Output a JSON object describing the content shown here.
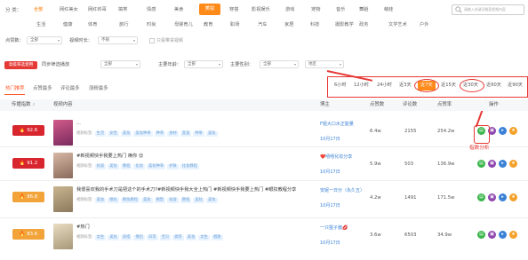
{
  "category": {
    "label": "分  类：",
    "row1": [
      "全部",
      "网红美女",
      "网红帅哥",
      "搞笑",
      "情感",
      "美食",
      "美妆",
      "穿搭",
      "影视娱乐",
      "游戏",
      "宠物",
      "音乐",
      "舞蹈",
      "萌娃"
    ],
    "row2": [
      "生活",
      "健康",
      "体育",
      "旅行",
      "时尚",
      "母婴育儿",
      "教育",
      "职场",
      "汽车",
      "家居",
      "科技",
      "摄影教学",
      "政务",
      "文学艺术",
      "户外"
    ],
    "selected_top": "全部",
    "active": "美妆"
  },
  "search": {
    "placeholder": "请输入关键词搜索视频内容"
  },
  "filters": {
    "fans_label": "点赞数：",
    "fans_value": "全部",
    "duration_label": "视频时长：",
    "duration_value": "不限",
    "checkbox_label": "只看带货视频"
  },
  "advanced": {
    "button": "高级筛选使用",
    "opt1_label": "同步筛选播放",
    "opt2_label": "首页发布：",
    "opt2_value": "全部",
    "opt3_label": "主要年龄：",
    "opt3_value": "全部",
    "opt4_label": "主要性别：",
    "opt4_value": "全部",
    "opt5_value": "地区"
  },
  "tabs": [
    "热门推荐",
    "点赞最多",
    "评论最多",
    "涨粉最多"
  ],
  "time_range": [
    "6小时",
    "12小时",
    "24小时",
    "近3天",
    "近7天",
    "近15天",
    "近30天",
    "近60天",
    "近90天"
  ],
  "time_selected": "近7天",
  "table": {
    "headers": {
      "score": "传播指数",
      "video": "视频内容",
      "blogger": "博主",
      "likes": "点赞数",
      "comments": "评论数",
      "plays": "点赞率",
      "ops": "操作"
    }
  },
  "rows": [
    {
      "score": "92.6",
      "title": "...",
      "tags_label": "视频标签:",
      "tags": [
        "生活",
        "女性",
        "美妆",
        "美妆种草",
        "种草",
        "身材",
        "变美",
        "种草",
        "美妆"
      ],
      "blogger": "F姐大口水正能量",
      "date": "10月17日",
      "likes": "6.4w",
      "comments": "2155",
      "plays": "254.2w"
    },
    {
      "score": "91.2",
      "title": "#新视频快手我要上热门 唤你 😍",
      "tags_label": "视频标签:",
      "tags": [
        "妆容",
        "美妆",
        "教程",
        "化妆",
        "美妆种草",
        "护肤",
        "化妆教程"
      ],
      "blogger": "❤️嘻嘻化妆分享",
      "date": "10月17日",
      "likes": "5.9w",
      "comments": "503",
      "plays": "136.9w"
    },
    {
      "score": "86.8",
      "title": "我很喜欢我的手术刀是把这个的手术刀?#新视频快手我大全上热门 #新视频快手我要上热门 #眼妆教程分享",
      "tags_label": "视频标签:",
      "tags": [
        "美妆",
        "眼妆",
        "眼妆教程",
        "美妆",
        "眼影",
        "妆容",
        "教程",
        "美妆",
        "美妆"
      ],
      "blogger": "安妮一日分（永久五）",
      "date": "10月17日",
      "likes": "4.2w",
      "comments": "1491",
      "plays": "171.5w"
    },
    {
      "score": "83.6",
      "title": "#热门",
      "tags_label": "视频标签:",
      "tags": [
        "女生",
        "美妆",
        "穿搭",
        "情侣",
        "日常",
        "宝贝",
        "搞笑",
        "美妆",
        "女生",
        "唱歌"
      ],
      "blogger": "一只猩子酱💋",
      "date": "10月17日",
      "likes": "3.6w",
      "comments": "6503",
      "plays": "34.9w"
    }
  ],
  "annotation": "指数分析",
  "colors": {
    "accent": "#ff8a1a",
    "highlight": "#e53935",
    "link": "#3b82d6"
  }
}
